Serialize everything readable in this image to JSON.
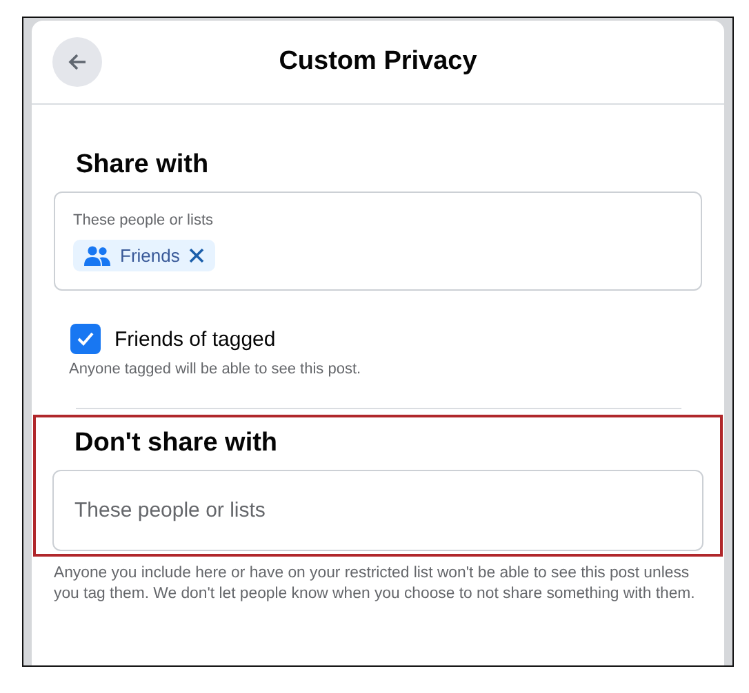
{
  "dialog": {
    "title": "Custom Privacy"
  },
  "share_with": {
    "heading": "Share with",
    "field_label": "These people or lists",
    "chips": [
      {
        "label": "Friends"
      }
    ]
  },
  "option": {
    "label": "Friends of tagged",
    "checked": true,
    "hint": "Anyone tagged will be able to see this post."
  },
  "dont_share_with": {
    "heading": "Don't share with",
    "highlighted": true,
    "placeholder": "These people or lists",
    "help": "Anyone you include here or have on your restricted list won't be able to see this post unless you tag them. We don't let people know when you choose to not share something with them."
  }
}
